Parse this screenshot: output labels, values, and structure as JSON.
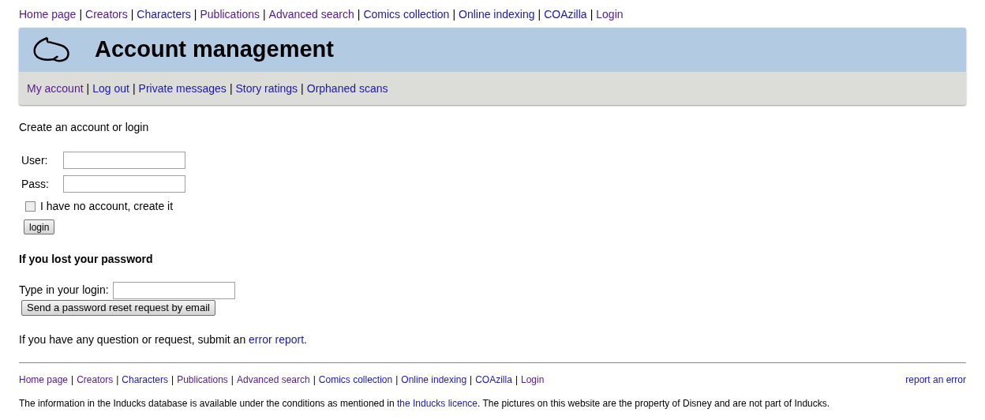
{
  "top_nav": [
    {
      "label": "Home page",
      "visited": true,
      "after": "|"
    },
    {
      "label": "Creators",
      "visited": true,
      "after": "|"
    },
    {
      "label": "Characters",
      "visited": false,
      "after": "|"
    },
    {
      "label": "Publications",
      "visited": true,
      "after": "|"
    },
    {
      "label": "Advanced search",
      "visited": true,
      "after": "|"
    },
    {
      "label": "Comics collection",
      "visited": false,
      "after": "|"
    },
    {
      "label": "Online indexing",
      "visited": false,
      "after": "|"
    },
    {
      "label": "COAzilla",
      "visited": false,
      "after": "|"
    },
    {
      "label": "Login",
      "visited": true
    }
  ],
  "header": {
    "title": "Account management",
    "sub_nav": [
      {
        "label": "My account",
        "visited": true,
        "after": "|"
      },
      {
        "label": "Log out",
        "visited": false,
        "after": "|"
      },
      {
        "label": "Private messages",
        "visited": false,
        "after": "|"
      },
      {
        "label": "Story ratings",
        "visited": false,
        "after": "|"
      },
      {
        "label": "Orphaned scans",
        "visited": false
      }
    ]
  },
  "intro": "Create an account or login",
  "login_form": {
    "fields": [
      {
        "label": "User:"
      },
      {
        "label": "Pass:"
      }
    ],
    "checkbox": {
      "label": "I have no account, create it",
      "checked": false
    },
    "button": "login"
  },
  "lost_password": {
    "heading": "If you lost your password",
    "field_label": "Type in your login:",
    "button": "Send a password reset request by email"
  },
  "question": {
    "text": "If you have any question or request, submit an",
    "link": "error report",
    "after": "."
  },
  "footer": {
    "nav": [
      {
        "label": "Home page",
        "visited": true,
        "after": "|"
      },
      {
        "label": "Creators",
        "visited": true,
        "after": "|"
      },
      {
        "label": "Characters",
        "visited": false,
        "after": "|"
      },
      {
        "label": "Publications",
        "visited": true,
        "after": "|"
      },
      {
        "label": "Advanced search",
        "visited": true,
        "after": "|"
      },
      {
        "label": "Comics collection",
        "visited": false,
        "after": "|"
      },
      {
        "label": "Online indexing",
        "visited": false,
        "after": "|"
      },
      {
        "label": "COAzilla",
        "visited": false,
        "after": "|"
      },
      {
        "label": "Login",
        "visited": true
      }
    ],
    "report_link": "report an error",
    "notice": {
      "before": "The information in the Inducks database is available under the conditions as mentioned in",
      "link": "the Inducks licence",
      "after": ". The pictures on this website are the property of Disney and are not part of Inducks."
    }
  }
}
